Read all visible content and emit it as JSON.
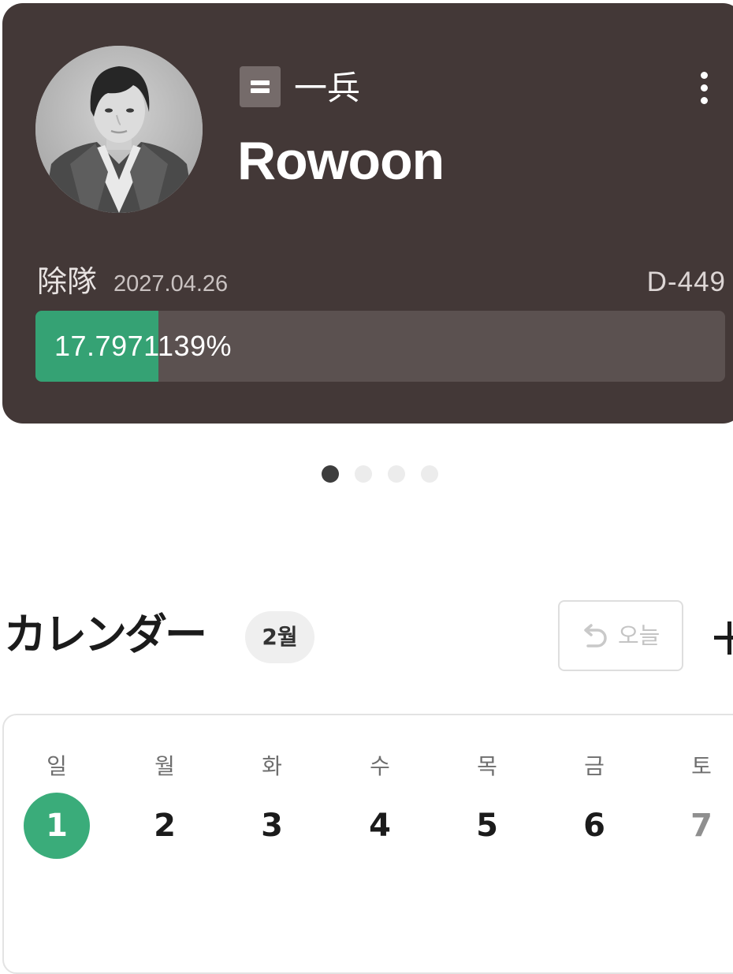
{
  "profile_card": {
    "rank_icon": "rank-two-bars-icon",
    "rank": "一兵",
    "name": "Rowoon",
    "discharge_label": "除隊",
    "discharge_date": "2027.04.26",
    "d_day": "D-449",
    "progress_text": "17.7971139%",
    "progress_value": 0.178,
    "colors": {
      "card_bg": "#433837",
      "progress_fill": "#35a274",
      "progress_track": "#5b5150"
    }
  },
  "pager": {
    "count": 4,
    "active_index": 0
  },
  "calendar": {
    "title": "カレンダー",
    "month": "2월",
    "today_button": "오늘",
    "weekdays": [
      "일",
      "월",
      "화",
      "수",
      "목",
      "금",
      "토"
    ],
    "days": [
      "1",
      "2",
      "3",
      "4",
      "5",
      "6",
      "7"
    ],
    "selected_day": "1",
    "accent_color": "#3aac7a"
  }
}
